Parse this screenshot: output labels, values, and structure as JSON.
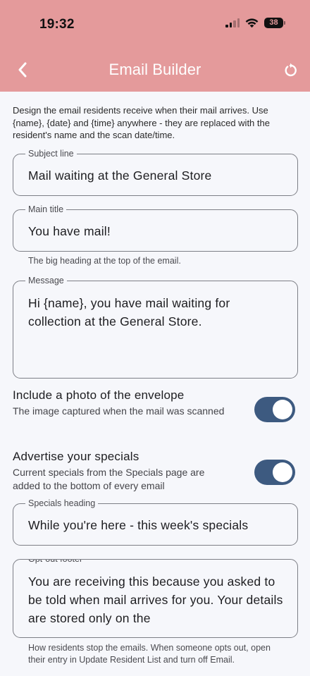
{
  "status_bar": {
    "time": "19:32",
    "battery": "38"
  },
  "app_bar": {
    "title": "Email Builder",
    "back_icon": "chevron-left-icon",
    "reset_icon": "refresh-icon"
  },
  "intro_text": "Design the email residents receive when their mail arrives. Use {name}, {date} and {time} anywhere - they are replaced with the resident's name and the scan date/time.",
  "fields": {
    "subject": {
      "label": "Subject line",
      "value": "Mail waiting at the General Store"
    },
    "title": {
      "label": "Main title",
      "value": "You have mail!",
      "helper": "The big heading at the top of the email."
    },
    "message": {
      "label": "Message",
      "value": "Hi {name}, you have mail waiting for collection at the General Store."
    },
    "specials_heading": {
      "label": "Specials heading",
      "value": "While you're here - this week's specials"
    },
    "opt_out": {
      "label": "Opt-out footer",
      "value": "You are receiving this because you asked to be told when mail arrives for you. Your details are stored only on the",
      "helper": "How residents stop the emails. When someone opts out, open their entry in Update Resident List and turn off Email."
    }
  },
  "toggles": {
    "photo": {
      "title": "Include a photo of the envelope",
      "description": "The image captured when the mail was scanned",
      "on": true
    },
    "specials": {
      "title": "Advertise your specials",
      "description": "Current specials from the Specials page are added to the bottom of every email",
      "on": true
    }
  },
  "colors": {
    "header": "#e49a9b",
    "switch_on": "#3d5a80",
    "background": "#f6f7fb"
  }
}
